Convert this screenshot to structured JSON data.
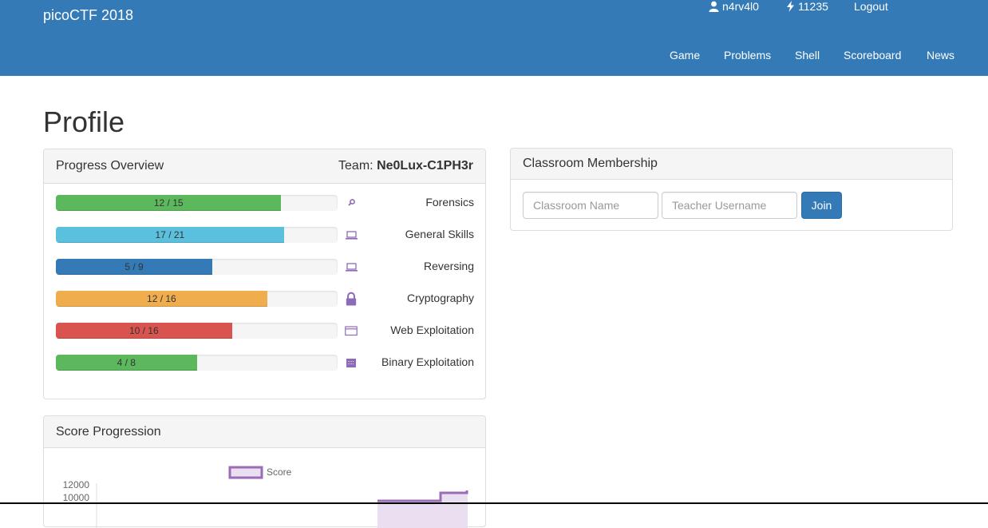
{
  "navbar": {
    "brand": "picoCTF 2018",
    "username": "n4rv4l0",
    "score": "11235",
    "logout_label": "Logout",
    "links": [
      "Game",
      "Problems",
      "Shell",
      "Scoreboard",
      "News"
    ],
    "bg_color": "#337ab7"
  },
  "page": {
    "title": "Profile"
  },
  "progress": {
    "heading": "Progress Overview",
    "team_label": "Team:",
    "team_name": "Ne0Lux-C1PH3r",
    "categories": [
      {
        "name": "Forensics",
        "text": "12 / 15",
        "solved": 12,
        "total": 15,
        "color": "#5cb85c",
        "icon": "magnifier-icon"
      },
      {
        "name": "General Skills",
        "text": "17 / 21",
        "solved": 17,
        "total": 21,
        "color": "#5bc0de",
        "icon": "laptop-icon"
      },
      {
        "name": "Reversing",
        "text": "5 / 9",
        "solved": 5,
        "total": 9,
        "color": "#337ab7",
        "icon": "laptop-icon"
      },
      {
        "name": "Cryptography",
        "text": "12 / 16",
        "solved": 12,
        "total": 16,
        "color": "#f0ad4e",
        "icon": "lock-icon"
      },
      {
        "name": "Web Exploitation",
        "text": "10 / 16",
        "solved": 10,
        "total": 16,
        "color": "#d9534f",
        "icon": "browser-window-icon"
      },
      {
        "name": "Binary Exploitation",
        "text": "4 / 8",
        "solved": 4,
        "total": 8,
        "color": "#5cb85c",
        "icon": "binary-chip-icon"
      }
    ],
    "icon_color": "#8e6bb8"
  },
  "score_progression": {
    "heading": "Score Progression",
    "legend": "Score",
    "y_ticks": [
      "12000",
      "10000"
    ],
    "line_color": "#9b6bb5"
  },
  "classroom": {
    "heading": "Classroom Membership",
    "classroom_placeholder": "Classroom Name",
    "teacher_placeholder": "Teacher Username",
    "join_label": "Join"
  }
}
